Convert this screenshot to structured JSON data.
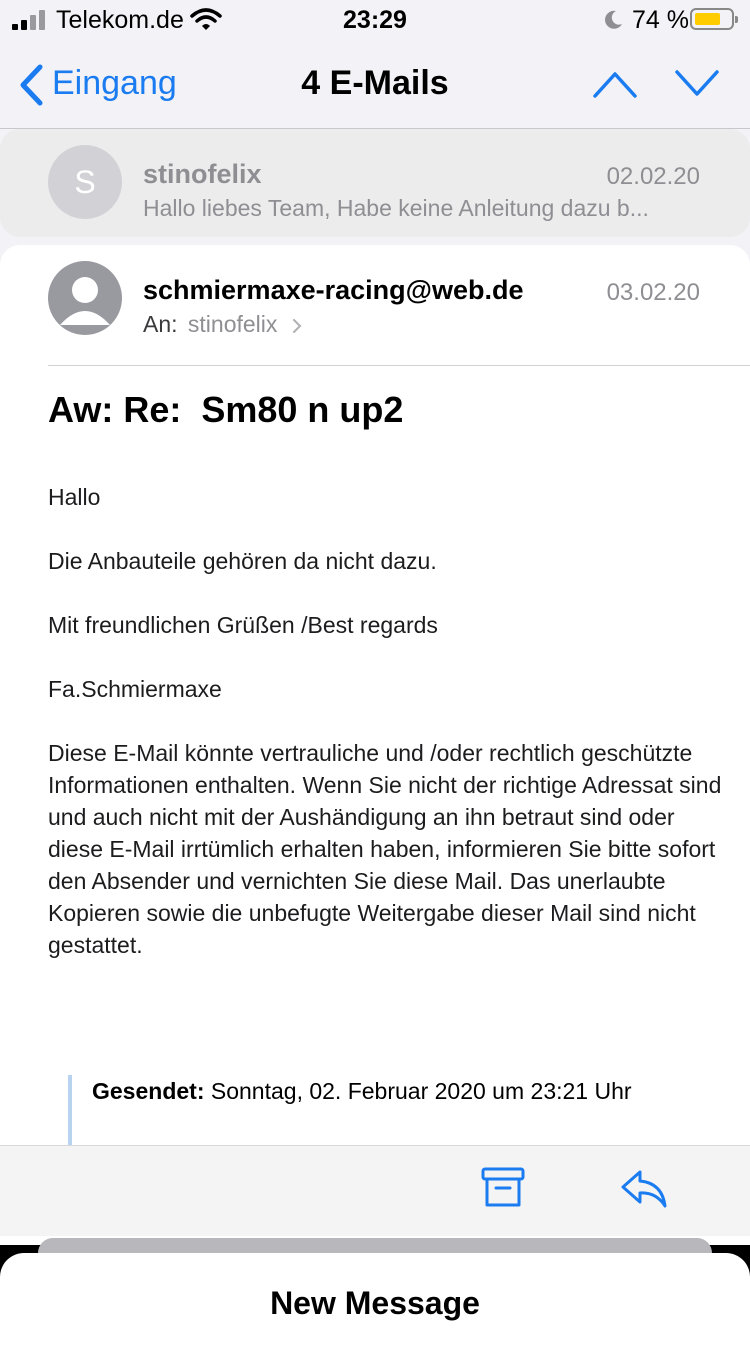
{
  "status_bar": {
    "carrier": "Telekom.de",
    "time": "23:29",
    "battery_percent": "74 %",
    "battery_level": 0.74,
    "battery_color": "#ffcc00"
  },
  "nav": {
    "back_label": "Eingang",
    "title": "4 E-Mails",
    "accent_color": "#1a7cf0"
  },
  "collapsed_message": {
    "avatar_initial": "S",
    "from": "stinofelix",
    "date": "02.02.20",
    "preview": "Hallo liebes Team, Habe keine Anleitung dazu b..."
  },
  "open_message": {
    "from": "schmiermaxe-racing@web.de",
    "date": "03.02.20",
    "to_label": "An:",
    "to_name": "stinofelix",
    "subject": "Aw: Re:  Sm80 n up2",
    "body": [
      "Hallo",
      "Die Anbauteile gehören da nicht dazu.",
      "Mit freundlichen Grüßen /Best regards",
      "Fa.Schmiermaxe",
      "Diese E-Mail könnte vertrauliche und /oder rechtlich geschützte Informationen enthalten. Wenn Sie nicht der richtige Adressat sind und auch nicht mit der Aushändigung an ihn betraut sind oder diese E-Mail irrtümlich erhalten haben, informieren Sie bitte sofort den Absender und vernichten Sie diese Mail. Das unerlaubte Kopieren sowie die unbefugte Weitergabe dieser Mail sind nicht gestattet."
    ],
    "quote_label": "Gesendet:",
    "quote_value": "Sonntag, 02. Februar 2020 um 23:21 Uhr"
  },
  "toolbar": {
    "icons": [
      "archive-icon",
      "reply-icon"
    ]
  },
  "new_message_sheet": {
    "title": "New Message"
  }
}
